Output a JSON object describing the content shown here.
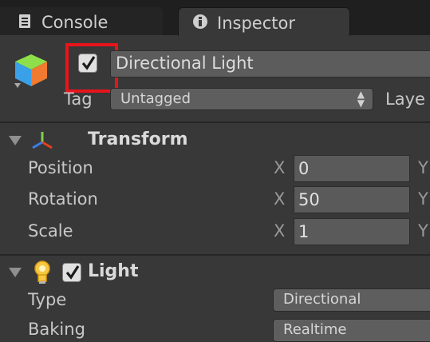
{
  "tabs": [
    {
      "label": "Console",
      "icon": "console-icon",
      "active": false
    },
    {
      "label": "Inspector",
      "icon": "info-icon",
      "active": true
    }
  ],
  "header": {
    "icon": "gameobject-cube-icon",
    "active_checked": true,
    "name": "Directional Light",
    "tag_label": "Tag",
    "tag_value": "Untagged",
    "layer_label": "Laye"
  },
  "transform": {
    "title": "Transform",
    "rows": [
      {
        "label": "Position",
        "axis": "X",
        "x": "0",
        "next_axis": "Y"
      },
      {
        "label": "Rotation",
        "axis": "X",
        "x": "50",
        "next_axis": "Y"
      },
      {
        "label": "Scale",
        "axis": "X",
        "x": "1",
        "next_axis": "Y"
      }
    ]
  },
  "light": {
    "title": "Light",
    "enabled": true,
    "type_label": "Type",
    "type_value": "Directional",
    "baking_label": "Baking",
    "baking_value": "Realtime"
  },
  "colors": {
    "highlight": "#e8141c",
    "panel": "#383838",
    "tabbar": "#1f1f1f"
  }
}
